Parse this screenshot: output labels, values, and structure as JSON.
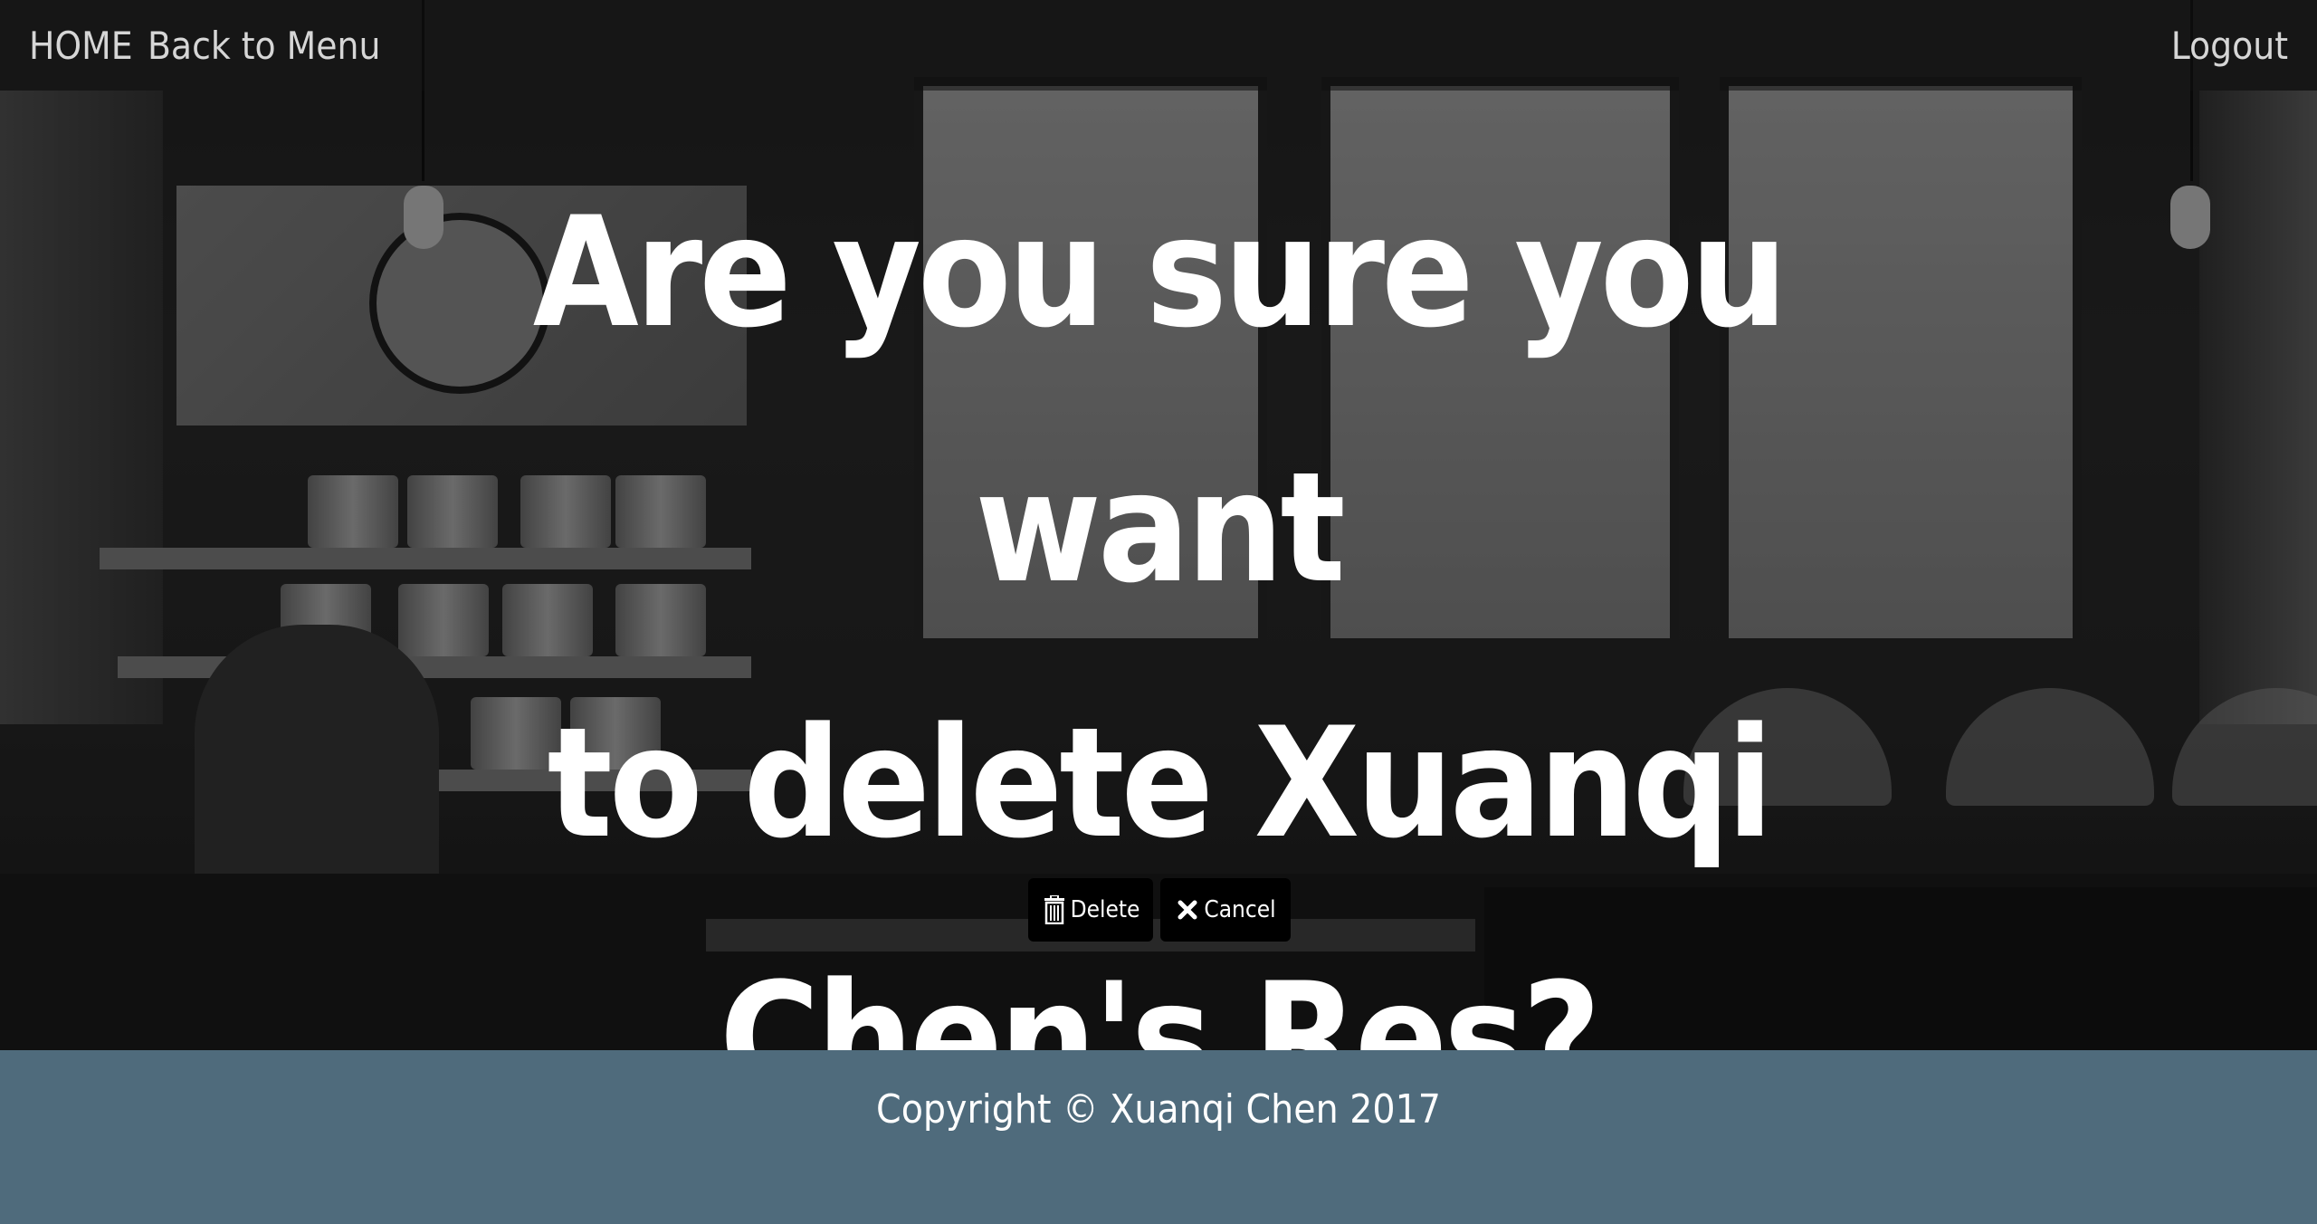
{
  "nav": {
    "home_label": "HOME",
    "back_label": "Back to Menu",
    "logout_label": "Logout"
  },
  "confirm": {
    "line1": "Are you sure you want",
    "line2": "to delete Xuanqi",
    "line3": "Chen's Res?"
  },
  "actions": {
    "delete_label": "Delete",
    "cancel_label": "Cancel",
    "delete_icon": "trash-icon",
    "cancel_icon": "close-icon"
  },
  "footer": {
    "copyright": "Copyright © Xuanqi Chen 2017",
    "color": "#4f6b7c"
  }
}
